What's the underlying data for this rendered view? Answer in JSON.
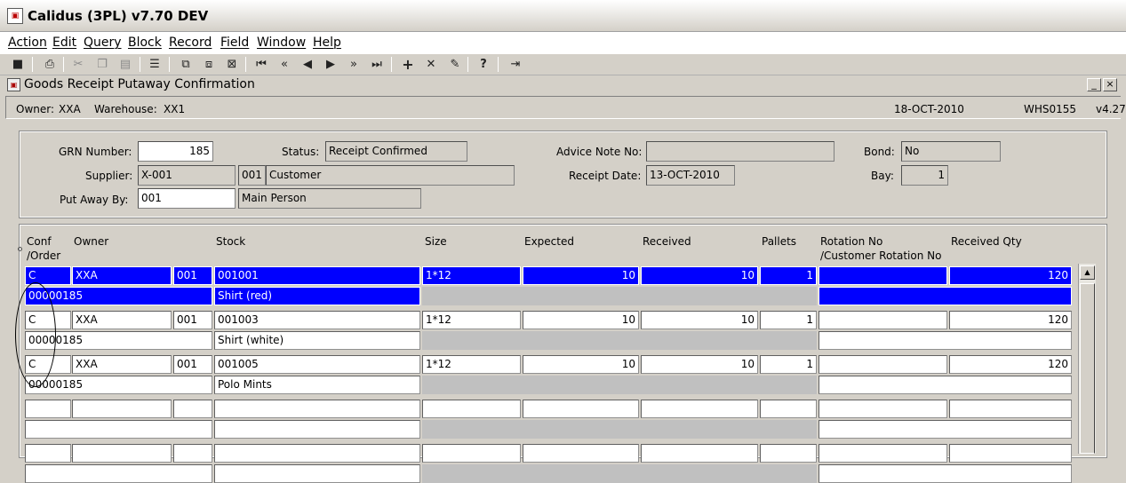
{
  "app": {
    "title": "Calidus (3PL) v7.70 DEV",
    "icon": "app-icon"
  },
  "menu": [
    "Action",
    "Edit",
    "Query",
    "Block",
    "Record",
    "Field",
    "Window",
    "Help"
  ],
  "toolbar": {
    "icons": [
      "save-icon",
      "print-icon",
      "cut-icon",
      "copy-icon",
      "paste-icon",
      "list-icon",
      "enter-query-icon",
      "execute-query-icon",
      "cancel-query-icon",
      "first-record-icon",
      "previous-block-icon",
      "previous-record-icon",
      "next-record-icon",
      "next-block-icon",
      "last-record-icon",
      "insert-record-icon",
      "delete-record-icon",
      "clear-record-icon",
      "help-icon",
      "exit-icon"
    ]
  },
  "window": {
    "title": "Goods Receipt Putaway Confirmation",
    "minimize": "_",
    "close": "×"
  },
  "status": {
    "owner_label": "Owner:",
    "owner": "XXA",
    "warehouse_label": "Warehouse:",
    "warehouse": "XX1",
    "date": "18-OCT-2010",
    "screen": "WHS0155",
    "version": "v4.27"
  },
  "header": {
    "grn_label": "GRN Number:",
    "grn": "185",
    "status_label": "Status:",
    "status": "Receipt Confirmed",
    "advice_label": "Advice Note No:",
    "advice": "",
    "bond_label": "Bond:",
    "bond": "No",
    "supplier_label": "Supplier:",
    "supplier_code": "X-001",
    "supplier_num": "001",
    "supplier_name": "Customer",
    "receipt_date_label": "Receipt Date:",
    "receipt_date": "13-OCT-2010",
    "bay_label": "Bay:",
    "bay": "1",
    "putaway_label": "Put Away By:",
    "putaway_code": "001",
    "putaway_name": "Main Person"
  },
  "columns": {
    "conf": "Conf",
    "order": "/Order",
    "owner": "Owner",
    "stock": "Stock",
    "size": "Size",
    "expected": "Expected",
    "received": "Received",
    "pallets": "Pallets",
    "rotation": "Rotation No",
    "cust_rotation": "/Customer Rotation No",
    "received_qty": "Received Qty"
  },
  "rows": [
    {
      "conf": "C",
      "owner": "XXA",
      "owner_num": "001",
      "stock": "001001",
      "size": "1*12",
      "expected": "10",
      "received": "10",
      "pallets": "1",
      "rotation": "",
      "received_qty": "120",
      "order": "00000185",
      "description": "Shirt (red)",
      "cust_rotation": ""
    },
    {
      "conf": "C",
      "owner": "XXA",
      "owner_num": "001",
      "stock": "001003",
      "size": "1*12",
      "expected": "10",
      "received": "10",
      "pallets": "1",
      "rotation": "",
      "received_qty": "120",
      "order": "00000185",
      "description": "Shirt (white)",
      "cust_rotation": ""
    },
    {
      "conf": "C",
      "owner": "XXA",
      "owner_num": "001",
      "stock": "001005",
      "size": "1*12",
      "expected": "10",
      "received": "10",
      "pallets": "1",
      "rotation": "",
      "received_qty": "120",
      "order": "00000185",
      "description": "Polo Mints",
      "cust_rotation": ""
    }
  ],
  "colors": {
    "selected": "#0000ff",
    "background": "#d4d0c8"
  }
}
